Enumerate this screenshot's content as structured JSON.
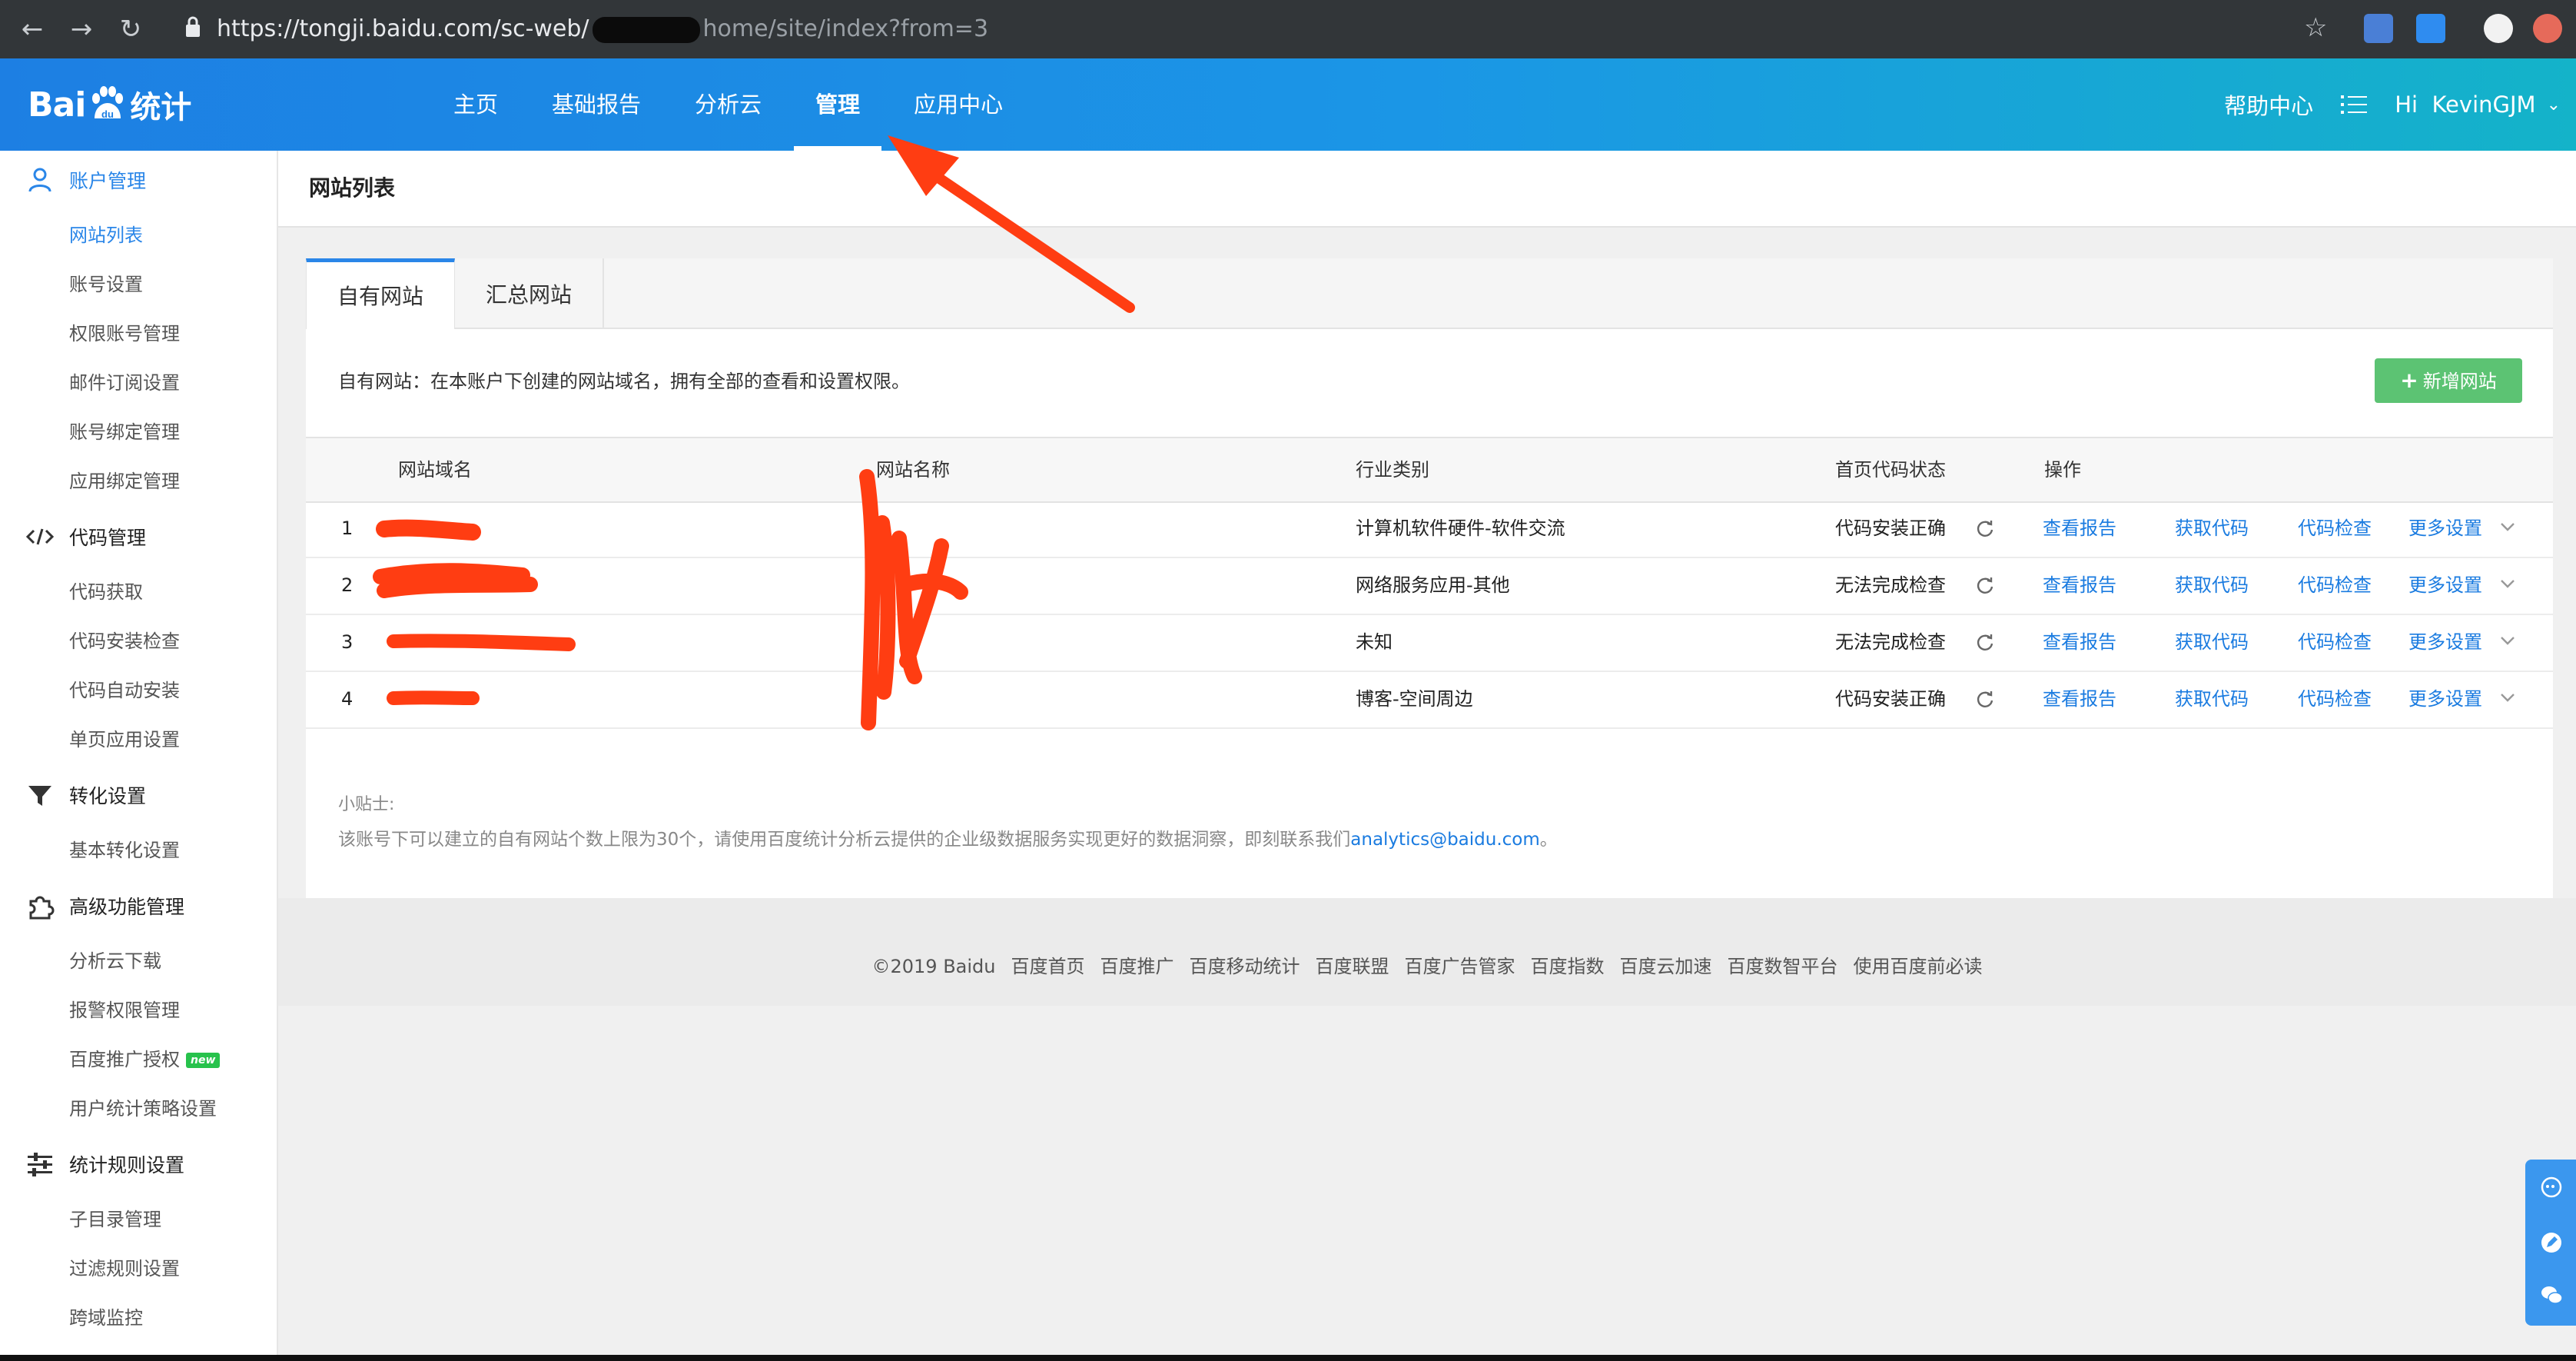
{
  "browser": {
    "url_prefix": "https://tongji.baidu.com/sc-web/",
    "url_suffix": "home/site/index?from=3",
    "back_icon": "arrow-left-icon",
    "forward_icon": "arrow-right-icon",
    "reload_icon": "reload-icon",
    "bookmark_icon": "star-icon"
  },
  "header": {
    "logo_text": "Bai",
    "logo_mark": "du",
    "logo_suffix": "统计",
    "nav": [
      {
        "label": "主页"
      },
      {
        "label": "基础报告"
      },
      {
        "label": "分析云"
      },
      {
        "label": "管理",
        "active": true
      },
      {
        "label": "应用中心"
      }
    ],
    "help": "帮助中心",
    "user": "Hi  KevinGJM"
  },
  "sidebar": {
    "groups": [
      {
        "label": "账户管理",
        "icon": "user-icon",
        "active": true,
        "items": [
          "网站列表",
          "账号设置",
          "权限账号管理",
          "邮件订阅设置",
          "账号绑定管理",
          "应用绑定管理"
        ]
      },
      {
        "label": "代码管理",
        "icon": "code-icon",
        "items": [
          "代码获取",
          "代码安装检查",
          "代码自动安装",
          "单页应用设置"
        ]
      },
      {
        "label": "转化设置",
        "icon": "funnel-icon",
        "items": [
          "基本转化设置"
        ]
      },
      {
        "label": "高级功能管理",
        "icon": "puzzle-icon",
        "items": [
          "分析云下载",
          "报警权限管理",
          "百度推广授权",
          "用户统计策略设置"
        ]
      },
      {
        "label": "统计规则设置",
        "icon": "sliders-icon",
        "items": [
          "子目录管理",
          "过滤规则设置",
          "跨域监控"
        ]
      }
    ],
    "new_badge": "new"
  },
  "page": {
    "title": "网站列表",
    "tabs": [
      "自有网站",
      "汇总网站"
    ],
    "intro": "自有网站：在本账户下创建的网站域名，拥有全部的查看和设置权限。",
    "add_button": "新增网站",
    "columns": [
      "网站域名",
      "网站名称",
      "行业类别",
      "首页代码状态",
      "操作"
    ],
    "rows": [
      {
        "index": "1",
        "industry": "计算机软件硬件-软件交流",
        "status": "代码安装正确"
      },
      {
        "index": "2",
        "industry": "网络服务应用-其他",
        "status": "无法完成检查"
      },
      {
        "index": "3",
        "industry": "未知",
        "status": "无法完成检查"
      },
      {
        "index": "4",
        "industry": "博客-空间周边",
        "status": "代码安装正确"
      }
    ],
    "actions": [
      "查看报告",
      "获取代码",
      "代码检查",
      "更多设置"
    ],
    "tips_title": "小贴士:",
    "tips_body": "该账号下可以建立的自有网站个数上限为30个，请使用百度统计分析云提供的企业级数据服务实现更好的数据洞察，即刻联系我们",
    "tips_email": "analytics@baidu.com",
    "tips_end": "。"
  },
  "footer": {
    "links": [
      "©2019 Baidu",
      "百度首页",
      "百度推广",
      "百度移动统计",
      "百度联盟",
      "百度广告管家",
      "百度指数",
      "百度云加速",
      "百度数智平台",
      "使用百度前必读"
    ]
  },
  "colors": {
    "header_start": "#1d7fe3",
    "header_end": "#14b3c9",
    "link": "#1a7be0",
    "add_button": "#5cc373",
    "annotation": "#ff3d12"
  }
}
